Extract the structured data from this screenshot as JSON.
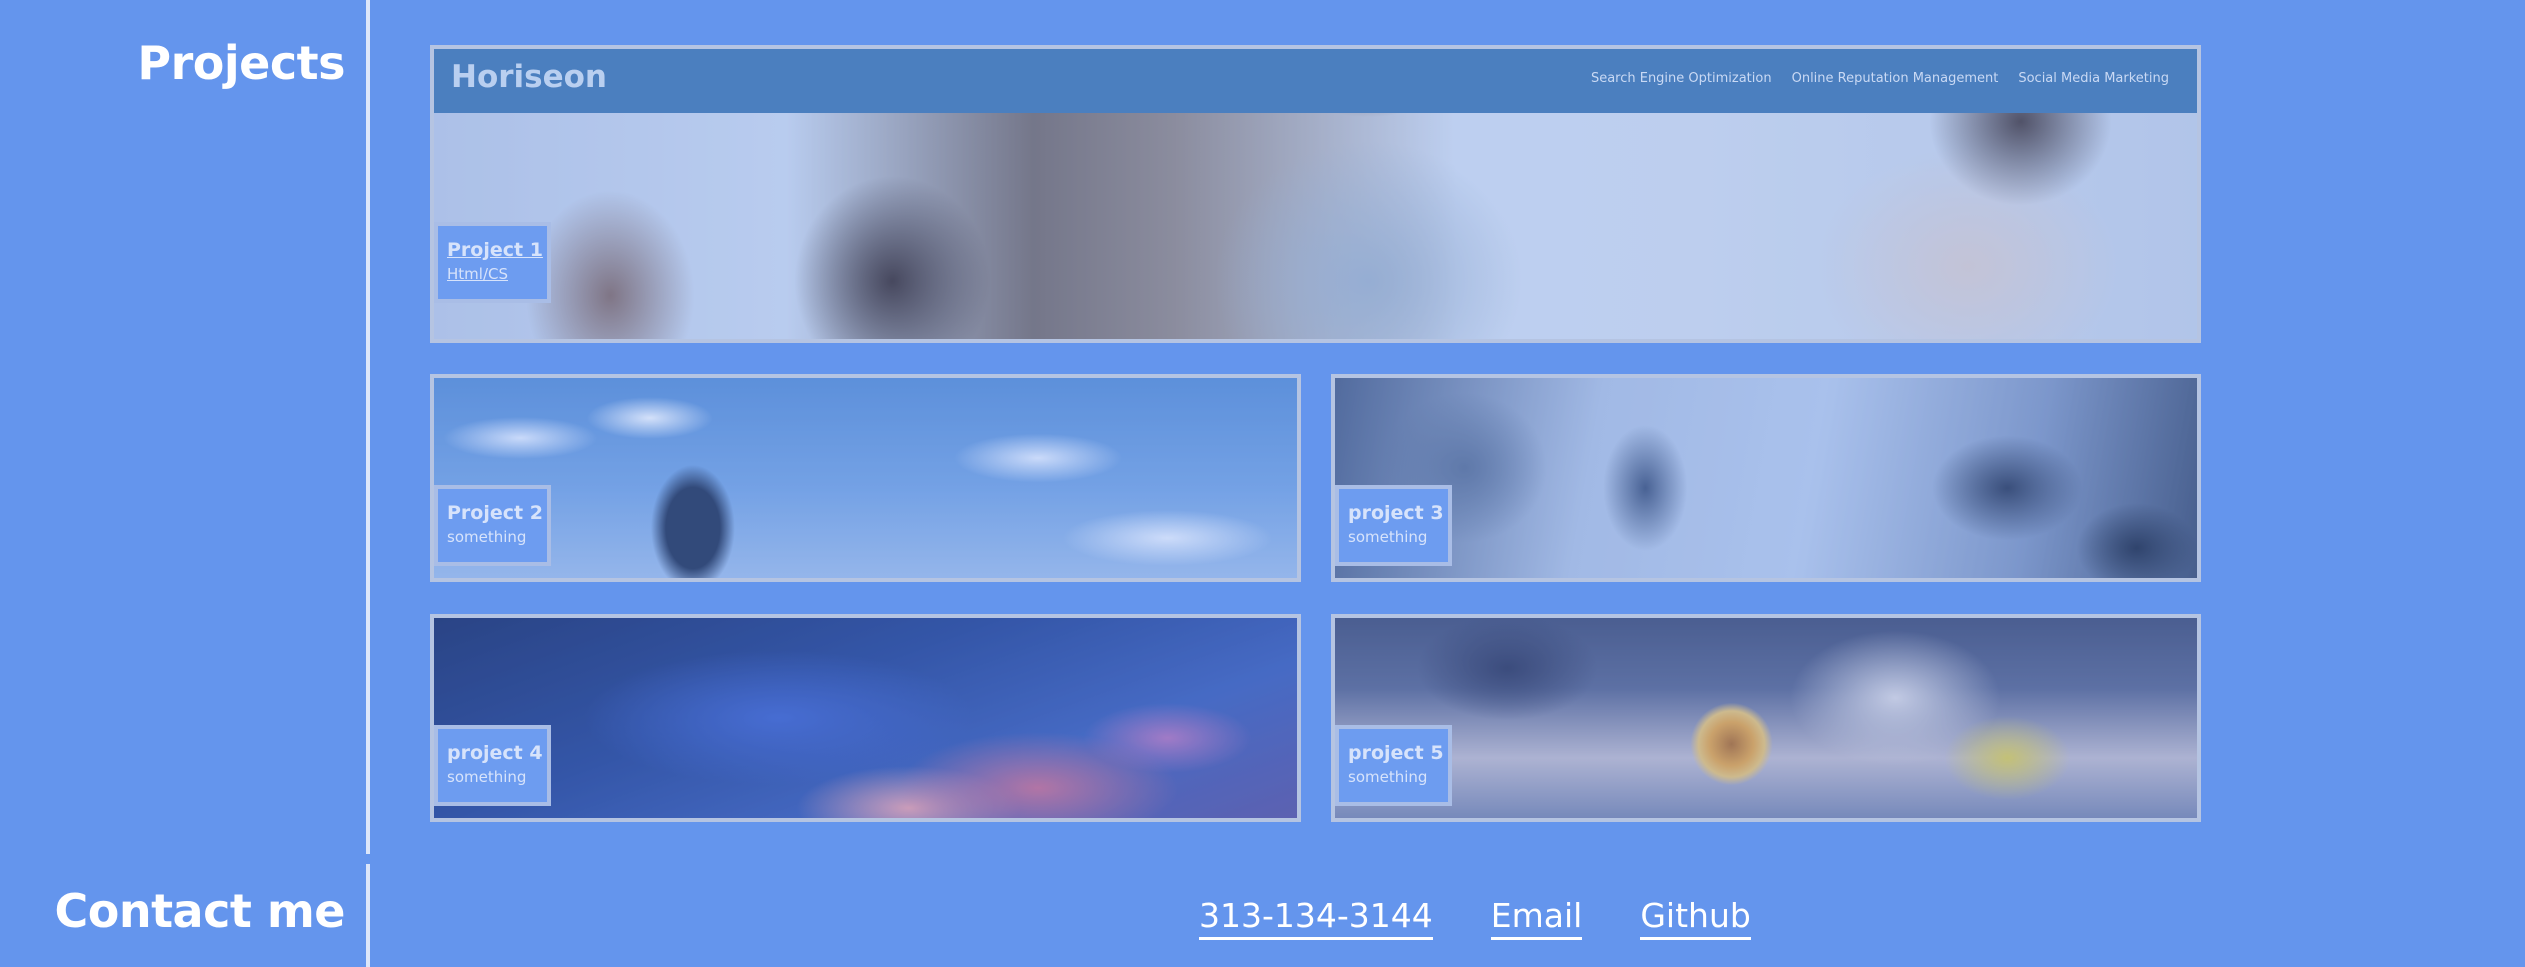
{
  "sections": {
    "projects_title": "Projects",
    "contact_title": "Contact me"
  },
  "projects": [
    {
      "title": "Project 1",
      "subtitle": "Html/CS"
    },
    {
      "title": "Project 2",
      "subtitle": "something"
    },
    {
      "title": "project 3",
      "subtitle": "something"
    },
    {
      "title": "project 4",
      "subtitle": "something"
    },
    {
      "title": "project 5",
      "subtitle": "something"
    }
  ],
  "horiseon": {
    "brand": "Horiseon",
    "nav": [
      "Search Engine Optimization",
      "Online Reputation Management",
      "Social Media Marketing"
    ]
  },
  "contact": {
    "phone": "313-134-3144",
    "email": "Email",
    "github": "Github"
  },
  "colors": {
    "background": "#6495ed",
    "card_border": "#b5c4e2",
    "label_bg": "#6d9cf0",
    "header_bar": "#4b7fbf",
    "text": "#ffffff"
  }
}
